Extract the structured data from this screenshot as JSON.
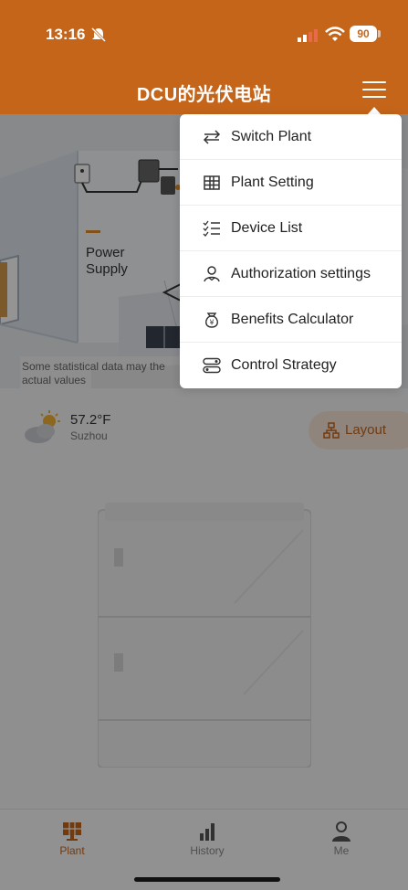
{
  "status": {
    "time": "13:16",
    "battery": "90"
  },
  "nav": {
    "title": "DCU的光伏电站"
  },
  "scene": {
    "power_label": "Power\nSupply",
    "notice": "Some statistical data may the actual values"
  },
  "weather": {
    "temp": "57.2°F",
    "city": "Suzhou"
  },
  "layout_button": {
    "label": "Layout"
  },
  "menu": {
    "items": [
      {
        "label": "Switch Plant",
        "icon": "switch-arrows-icon"
      },
      {
        "label": "Plant Setting",
        "icon": "grid-table-icon"
      },
      {
        "label": "Device List",
        "icon": "checklist-icon"
      },
      {
        "label": "Authorization settings",
        "icon": "user-icon"
      },
      {
        "label": "Benefits Calculator",
        "icon": "money-bag-icon"
      },
      {
        "label": "Control Strategy",
        "icon": "toggle-strategy-icon"
      }
    ]
  },
  "tabs": [
    {
      "label": "Plant",
      "active": true
    },
    {
      "label": "History",
      "active": false
    },
    {
      "label": "Me",
      "active": false
    }
  ],
  "colors": {
    "brand": "#c4651a",
    "brand_light": "#f7e6d7"
  }
}
